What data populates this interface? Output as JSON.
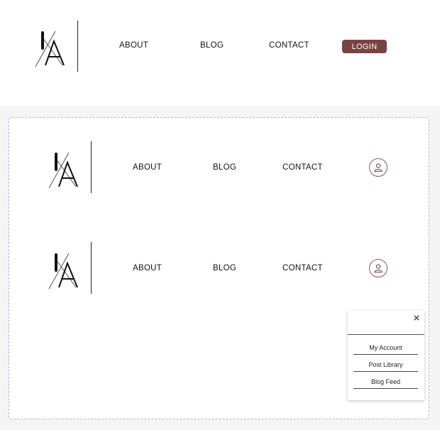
{
  "logo": {
    "text": "IA"
  },
  "nav": {
    "about": "ABOUT",
    "blog": "BLOG",
    "contact": "CONTACT",
    "login": "LOGIN"
  },
  "dropdown": {
    "close_icon": "×",
    "items": [
      "My Account",
      "Post Library",
      "Blog Feed"
    ]
  },
  "colors": {
    "accent": "#7a4343",
    "variant_border": "#b7a9e6"
  }
}
